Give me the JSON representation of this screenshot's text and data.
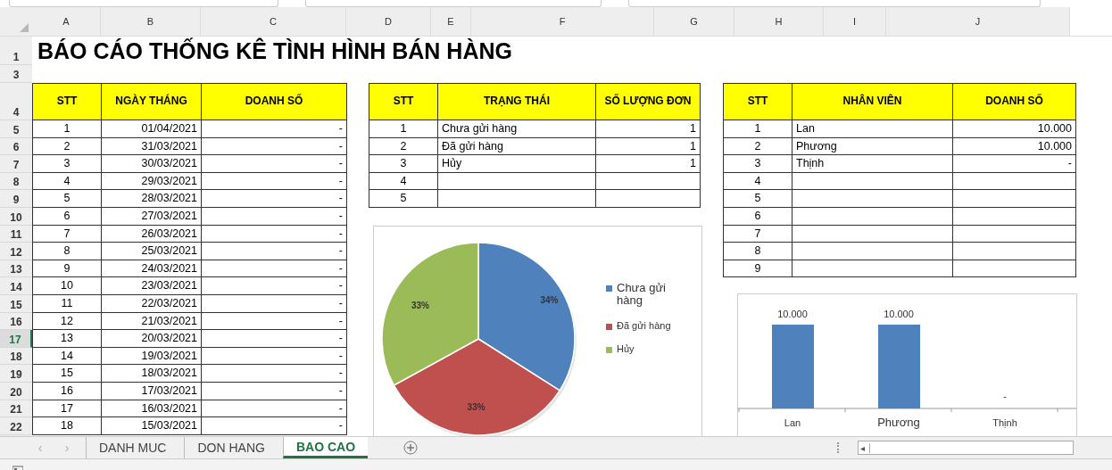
{
  "column_headers": [
    "A",
    "B",
    "C",
    "D",
    "E",
    "F",
    "G",
    "H",
    "I",
    "J"
  ],
  "row_headers": [
    {
      "label": "1",
      "selected": false
    },
    {
      "label": "3",
      "selected": false
    },
    {
      "label": "4",
      "selected": false
    },
    {
      "label": "5",
      "selected": false
    },
    {
      "label": "6",
      "selected": false
    },
    {
      "label": "7",
      "selected": false
    },
    {
      "label": "8",
      "selected": false
    },
    {
      "label": "9",
      "selected": false
    },
    {
      "label": "10",
      "selected": false
    },
    {
      "label": "11",
      "selected": false
    },
    {
      "label": "12",
      "selected": false
    },
    {
      "label": "13",
      "selected": false
    },
    {
      "label": "14",
      "selected": false
    },
    {
      "label": "15",
      "selected": false
    },
    {
      "label": "16",
      "selected": false
    },
    {
      "label": "17",
      "selected": true
    },
    {
      "label": "18",
      "selected": false
    },
    {
      "label": "19",
      "selected": false
    },
    {
      "label": "20",
      "selected": false
    },
    {
      "label": "21",
      "selected": false
    },
    {
      "label": "22",
      "selected": false
    }
  ],
  "title": "BÁO CÁO THỐNG KÊ TÌNH HÌNH BÁN HÀNG",
  "sales_by_date": {
    "columns": [
      "STT",
      "NGÀY THÁNG",
      "DOANH SỐ"
    ],
    "rows": [
      [
        "1",
        "01/04/2021",
        "-"
      ],
      [
        "2",
        "31/03/2021",
        "-"
      ],
      [
        "3",
        "30/03/2021",
        "-"
      ],
      [
        "4",
        "29/03/2021",
        "-"
      ],
      [
        "5",
        "28/03/2021",
        "-"
      ],
      [
        "6",
        "27/03/2021",
        "-"
      ],
      [
        "7",
        "26/03/2021",
        "-"
      ],
      [
        "8",
        "25/03/2021",
        "-"
      ],
      [
        "9",
        "24/03/2021",
        "-"
      ],
      [
        "10",
        "23/03/2021",
        "-"
      ],
      [
        "11",
        "22/03/2021",
        "-"
      ],
      [
        "12",
        "21/03/2021",
        "-"
      ],
      [
        "13",
        "20/03/2021",
        "-"
      ],
      [
        "14",
        "19/03/2021",
        "-"
      ],
      [
        "15",
        "18/03/2021",
        "-"
      ],
      [
        "16",
        "17/03/2021",
        "-"
      ],
      [
        "17",
        "16/03/2021",
        "-"
      ],
      [
        "18",
        "15/03/2021",
        "-"
      ]
    ]
  },
  "orders_by_status": {
    "columns": [
      "STT",
      "TRẠNG THÁI",
      "SỐ LƯỢNG ĐƠN"
    ],
    "rows": [
      [
        "1",
        "Chưa gửi hàng",
        "1"
      ],
      [
        "2",
        "Đã gửi hàng",
        "1"
      ],
      [
        "3",
        "Hủy",
        "1"
      ],
      [
        "4",
        "",
        ""
      ],
      [
        "5",
        "",
        ""
      ]
    ],
    "chart_data": {
      "type": "pie",
      "legend": "right",
      "categories": [
        "Chưa gửi hàng",
        "Đã gửi hàng",
        "Hủy"
      ],
      "values": [
        34,
        33,
        33
      ],
      "colors": [
        "#4f81bd",
        "#c0504d",
        "#9bbb59"
      ],
      "value_labels": [
        "34%",
        "33%",
        "33%"
      ]
    }
  },
  "sales_by_staff": {
    "columns": [
      "STT",
      "NHÂN VIÊN",
      "DOANH SỐ"
    ],
    "rows": [
      [
        "1",
        "Lan",
        "10.000"
      ],
      [
        "2",
        "Phương",
        "10.000"
      ],
      [
        "3",
        "Thịnh",
        "-"
      ],
      [
        "4",
        "",
        ""
      ],
      [
        "5",
        "",
        ""
      ],
      [
        "6",
        "",
        ""
      ],
      [
        "7",
        "",
        ""
      ],
      [
        "8",
        "",
        ""
      ],
      [
        "9",
        "",
        ""
      ]
    ],
    "chart_data": {
      "type": "bar",
      "categories": [
        "Lan",
        "Phương",
        "Thịnh"
      ],
      "values": [
        10000,
        10000,
        0
      ],
      "color": "#4f81bd",
      "value_labels": [
        "10.000",
        "10.000",
        "-"
      ]
    }
  },
  "sheet_nav": [
    "‹",
    "›"
  ],
  "scroll_arrow": "◂",
  "sheet_tabs": [
    {
      "label": "DANH MUC",
      "selected": false
    },
    {
      "label": "DON HANG",
      "selected": false
    },
    {
      "label": "BAO CAO",
      "selected": true
    }
  ]
}
